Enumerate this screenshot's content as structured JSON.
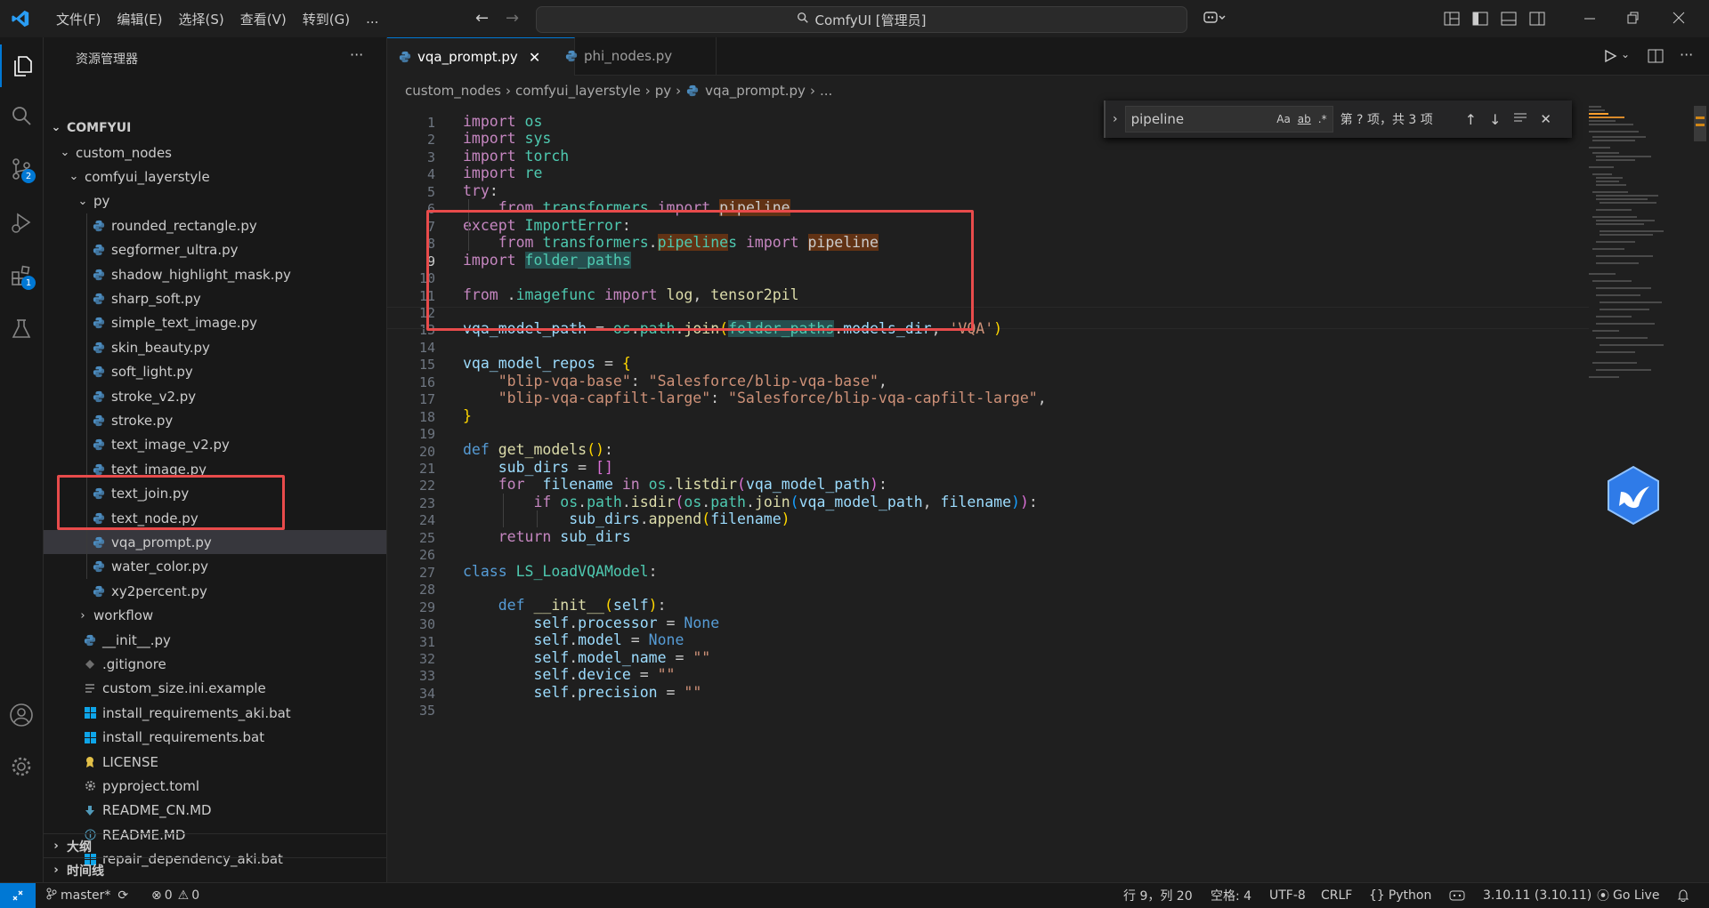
{
  "titlebar": {
    "menu": [
      "文件(F)",
      "编辑(E)",
      "选择(S)",
      "查看(V)",
      "转到(G)",
      "..."
    ],
    "command_center": "ComfyUI [管理员]"
  },
  "activity_bar": {
    "scm_badge": "2",
    "extensions_badge": "1"
  },
  "sidebar": {
    "title": "资源管理器",
    "more": "···",
    "root": "COMFYUI",
    "items": [
      {
        "label": "custom_nodes",
        "kind": "folder-open",
        "depth": 1
      },
      {
        "label": "comfyui_layerstyle",
        "kind": "folder-open",
        "depth": 2
      },
      {
        "label": "py",
        "kind": "folder-open",
        "depth": 3
      },
      {
        "label": "rounded_rectangle.py",
        "kind": "python",
        "depth": 4
      },
      {
        "label": "segformer_ultra.py",
        "kind": "python",
        "depth": 4
      },
      {
        "label": "shadow_highlight_mask.py",
        "kind": "python",
        "depth": 4
      },
      {
        "label": "sharp_soft.py",
        "kind": "python",
        "depth": 4
      },
      {
        "label": "simple_text_image.py",
        "kind": "python",
        "depth": 4
      },
      {
        "label": "skin_beauty.py",
        "kind": "python",
        "depth": 4
      },
      {
        "label": "soft_light.py",
        "kind": "python",
        "depth": 4
      },
      {
        "label": "stroke_v2.py",
        "kind": "python",
        "depth": 4
      },
      {
        "label": "stroke.py",
        "kind": "python",
        "depth": 4
      },
      {
        "label": "text_image_v2.py",
        "kind": "python",
        "depth": 4
      },
      {
        "label": "text_image.py",
        "kind": "python",
        "depth": 4
      },
      {
        "label": "text_join.py",
        "kind": "python",
        "depth": 4
      },
      {
        "label": "text_node.py",
        "kind": "python",
        "depth": 4
      },
      {
        "label": "vqa_prompt.py",
        "kind": "python",
        "depth": 4,
        "selected": true
      },
      {
        "label": "water_color.py",
        "kind": "python",
        "depth": 4
      },
      {
        "label": "xy2percent.py",
        "kind": "python",
        "depth": 4
      },
      {
        "label": "workflow",
        "kind": "folder-closed",
        "depth": 3
      },
      {
        "label": "__init__.py",
        "kind": "python",
        "depth": 3
      },
      {
        "label": ".gitignore",
        "kind": "gitignore",
        "depth": 3
      },
      {
        "label": "custom_size.ini.example",
        "kind": "text",
        "depth": 3
      },
      {
        "label": "install_requirements_aki.bat",
        "kind": "windows",
        "depth": 3
      },
      {
        "label": "install_requirements.bat",
        "kind": "windows",
        "depth": 3
      },
      {
        "label": "LICENSE",
        "kind": "license",
        "depth": 3
      },
      {
        "label": "pyproject.toml",
        "kind": "gear",
        "depth": 3
      },
      {
        "label": "README_CN.MD",
        "kind": "markdown",
        "depth": 3
      },
      {
        "label": "README.MD",
        "kind": "info",
        "depth": 3
      },
      {
        "label": "repair_dependency_aki.bat",
        "kind": "windows",
        "depth": 3
      }
    ],
    "outline": "大纲",
    "timeline": "时间线"
  },
  "tabs": [
    {
      "label": "vqa_prompt.py",
      "active": true
    },
    {
      "label": "phi_nodes.py",
      "active": false
    }
  ],
  "breadcrumbs": [
    "custom_nodes",
    "comfyui_layerstyle",
    "py",
    "vqa_prompt.py",
    "..."
  ],
  "find": {
    "query": "pipeline",
    "match_case": "Aa",
    "whole_word": "ab",
    "regex": ".*",
    "result": "第 ? 项，共 3 项"
  },
  "code": {
    "line_numbers": [
      "1",
      "2",
      "3",
      "4",
      "5",
      "6",
      "7",
      "8",
      "9",
      "10",
      "11",
      "12",
      "13",
      "14",
      "15",
      "16",
      "17",
      "18",
      "19",
      "20",
      "21",
      "22",
      "23",
      "24",
      "25",
      "26",
      "27",
      "28",
      "29",
      "30",
      "31",
      "32",
      "33",
      "34",
      "35"
    ]
  },
  "statusbar": {
    "branch": "master*",
    "errors": "0",
    "warnings": "0",
    "position": "行 9，列 20",
    "spaces": "空格: 4",
    "encoding": "UTF-8",
    "eol": "CRLF",
    "language": "Python",
    "interpreter": "3.10.11 (3.10.11)",
    "golive": "Go Live"
  },
  "colors": {
    "accent": "#0078d4",
    "annotation_box": "#e84b4b"
  }
}
